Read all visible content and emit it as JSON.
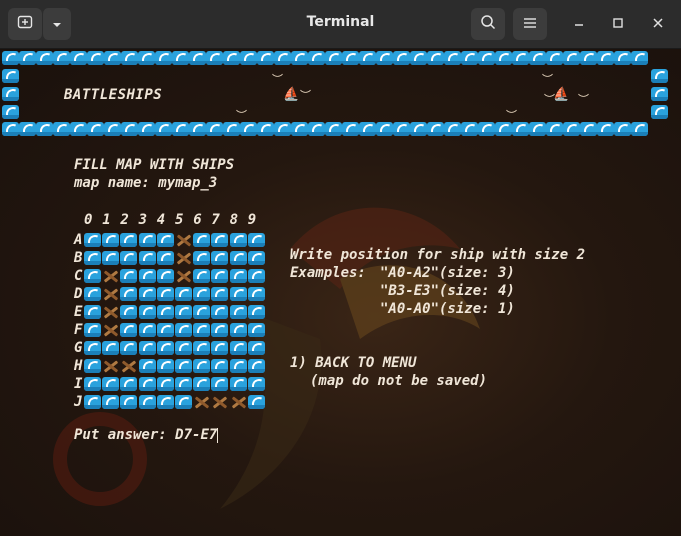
{
  "window": {
    "title": "Terminal",
    "new_tab_icon": "new-tab-icon",
    "menu_icon": "chevron-down-icon",
    "search_icon": "search-icon",
    "hamburger_icon": "hamburger-icon",
    "minimize_icon": "minimize-icon",
    "maximize_icon": "maximize-icon",
    "close_icon": "close-icon"
  },
  "game": {
    "title": "BATTLESHIPS",
    "heading": "FILL MAP WITH SHIPS",
    "map_name_line": "map name: mymap_3",
    "columns": [
      "0",
      "1",
      "2",
      "3",
      "4",
      "5",
      "6",
      "7",
      "8",
      "9"
    ],
    "rows": [
      {
        "label": "A",
        "cells": "WWWWWSWWWW"
      },
      {
        "label": "B",
        "cells": "WWWWWSWWWW"
      },
      {
        "label": "C",
        "cells": "WSWWWSWWWW"
      },
      {
        "label": "D",
        "cells": "WSWWWWWWWW"
      },
      {
        "label": "E",
        "cells": "WSWWWWWWWW"
      },
      {
        "label": "F",
        "cells": "WSWWWWWWWW"
      },
      {
        "label": "G",
        "cells": "WWWWWWWWWW"
      },
      {
        "label": "H",
        "cells": "WSSWWWWWWW"
      },
      {
        "label": "I",
        "cells": "WWWWWWWWWW"
      },
      {
        "label": "J",
        "cells": "WWWWWWSSSW"
      }
    ],
    "prompt_line": "Write position for ship with size 2",
    "examples_label": "Examples: ",
    "examples": [
      "\"A0-A2\"(size: 3)",
      "\"B3-E3\"(size: 4)",
      "\"A0-A0\"(size: 1)"
    ],
    "menu_option": "1) BACK TO MENU",
    "menu_note": "(map do not be saved)",
    "answer_label": "Put answer: ",
    "answer_value": "D7-E7"
  },
  "colors": {
    "wave": "#2aa2dd",
    "text": "#f0e6d8",
    "ship": "#b07a42"
  }
}
